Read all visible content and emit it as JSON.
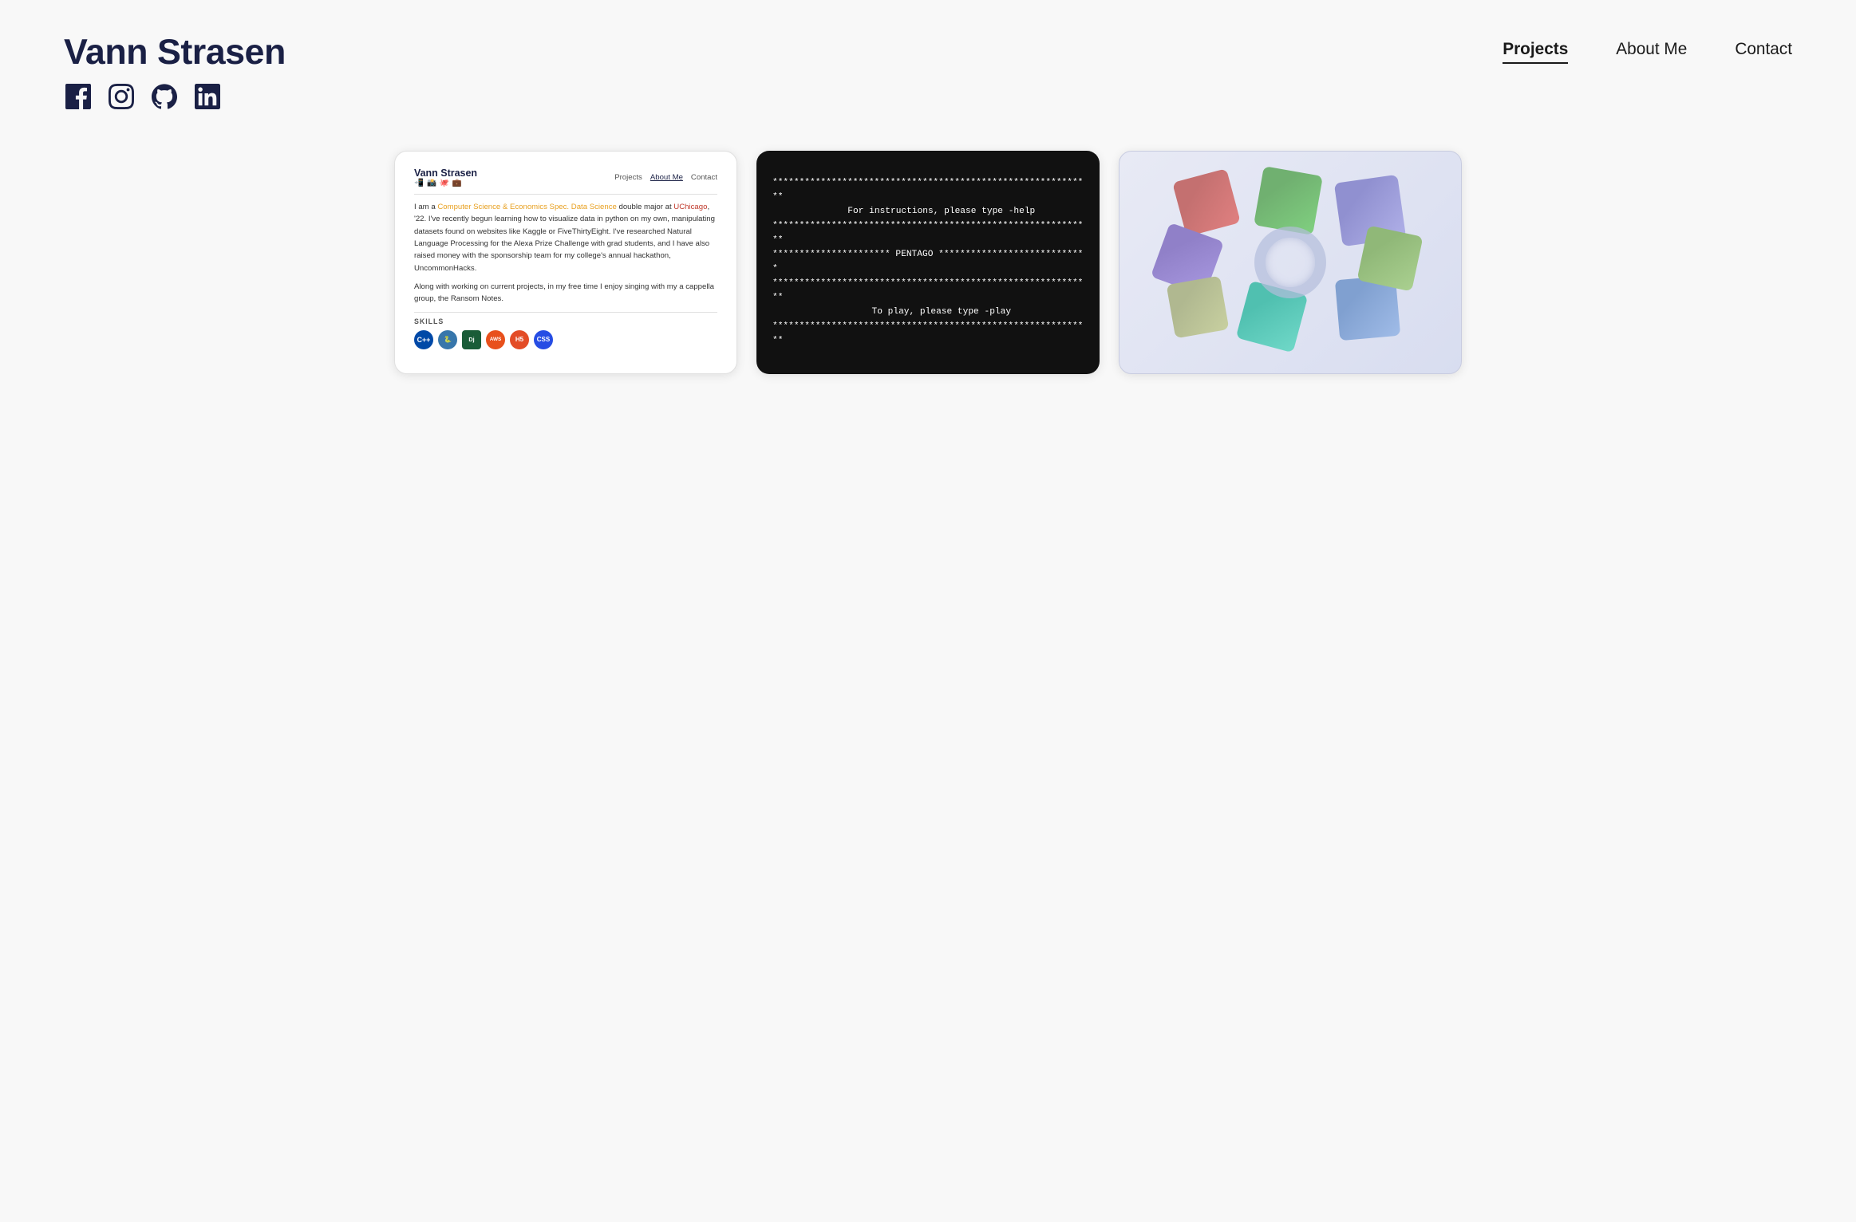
{
  "header": {
    "site_title": "Vann Strasen",
    "social_links": [
      {
        "name": "facebook",
        "label": "Facebook"
      },
      {
        "name": "instagram",
        "label": "Instagram"
      },
      {
        "name": "github",
        "label": "GitHub"
      },
      {
        "name": "linkedin",
        "label": "LinkedIn"
      }
    ]
  },
  "nav": {
    "items": [
      {
        "label": "Projects",
        "active": true
      },
      {
        "label": "About Me",
        "active": false
      },
      {
        "label": "Contact",
        "active": false
      }
    ]
  },
  "cards": {
    "portfolio_card": {
      "mini_title": "Vann Strasen",
      "mini_nav": [
        "Projects",
        "About Me",
        "Contact"
      ],
      "mini_nav_active": "About Me",
      "bio_p1_pre": "I am a ",
      "bio_link1": "Computer Science & Economics Spec. Data Science",
      "bio_p1_mid": " double major at ",
      "bio_link2": "UChicago",
      "bio_p1_post": ", '22. I've recently begun learning how to visualize data in python on my own, manipulating datasets found on websites like Kaggle or FiveThirtyEight. I've researched Natural Language Processing for the Alexa Prize Challenge with grad students, and I have also raised money with the sponsorship team for my college's annual hackathon, UncommonHacks.",
      "bio_p2": "Along with working on current projects, in my free time I enjoy singing with my a cappella group, the Ransom Notes.",
      "skills_label": "SKILLS",
      "skills": [
        {
          "label": "C++",
          "class": "badge-cpp"
        },
        {
          "label": "Py",
          "class": "badge-py"
        },
        {
          "label": "Dj",
          "class": "badge-django"
        },
        {
          "label": "AWS",
          "class": "badge-aws"
        },
        {
          "label": "H5",
          "class": "badge-html"
        },
        {
          "label": "CSS",
          "class": "badge-css"
        }
      ]
    },
    "terminal_card": {
      "lines": [
        "************************************************************",
        "",
        "     For instructions, please type -help",
        "",
        "************************************************************",
        "********************** PENTAGO ****************************",
        "************************************************************",
        "",
        "     To play, please type -play",
        "",
        "************************************************************"
      ]
    },
    "shapes_card": {
      "alt": "3D Shapes"
    }
  }
}
